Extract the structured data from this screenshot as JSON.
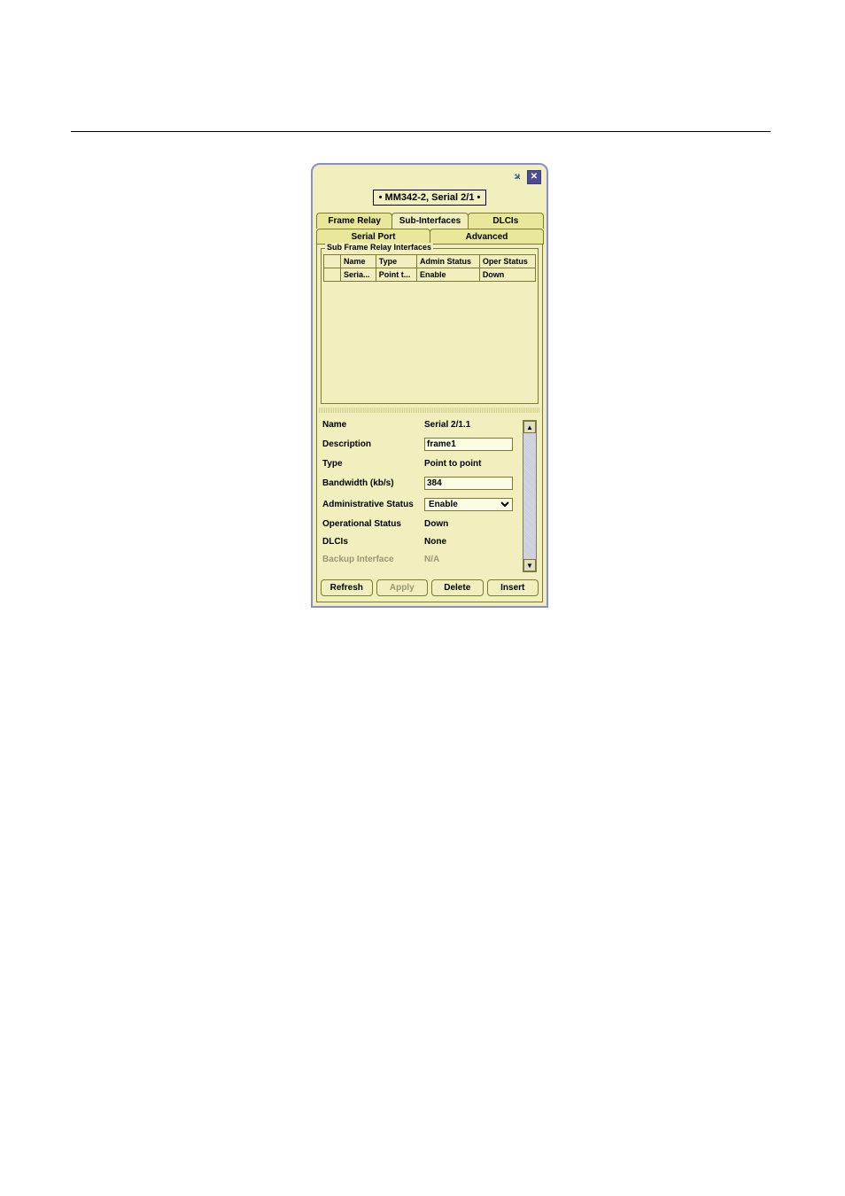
{
  "breadcrumb": "• MM342-2, Serial 2/1 •",
  "tabs": {
    "frame_relay": "Frame Relay",
    "sub_interfaces": "Sub-Interfaces",
    "dlcis": "DLCIs",
    "serial_port": "Serial Port",
    "advanced": "Advanced"
  },
  "fieldset_legend": "Sub Frame Relay Interfaces",
  "table": {
    "headers": {
      "name": "Name",
      "type": "Type",
      "admin": "Admin Status",
      "oper": "Oper Status"
    },
    "row0": {
      "name": "Seria...",
      "type": "Point t...",
      "admin": "Enable",
      "oper": "Down"
    }
  },
  "form": {
    "name_label": "Name",
    "name_value": "Serial 2/1.1",
    "desc_label": "Description",
    "desc_value": "frame1",
    "type_label": "Type",
    "type_value": "Point to point",
    "bw_label": "Bandwidth (kb/s)",
    "bw_value": "384",
    "admin_label": "Administrative Status",
    "admin_value": "Enable",
    "oper_label": "Operational Status",
    "oper_value": "Down",
    "dlcis_label": "DLCIs",
    "dlcis_value": "None",
    "backup_label": "Backup Interface",
    "backup_value": "N/A"
  },
  "buttons": {
    "refresh": "Refresh",
    "apply": "Apply",
    "delete": "Delete",
    "insert": "Insert"
  }
}
